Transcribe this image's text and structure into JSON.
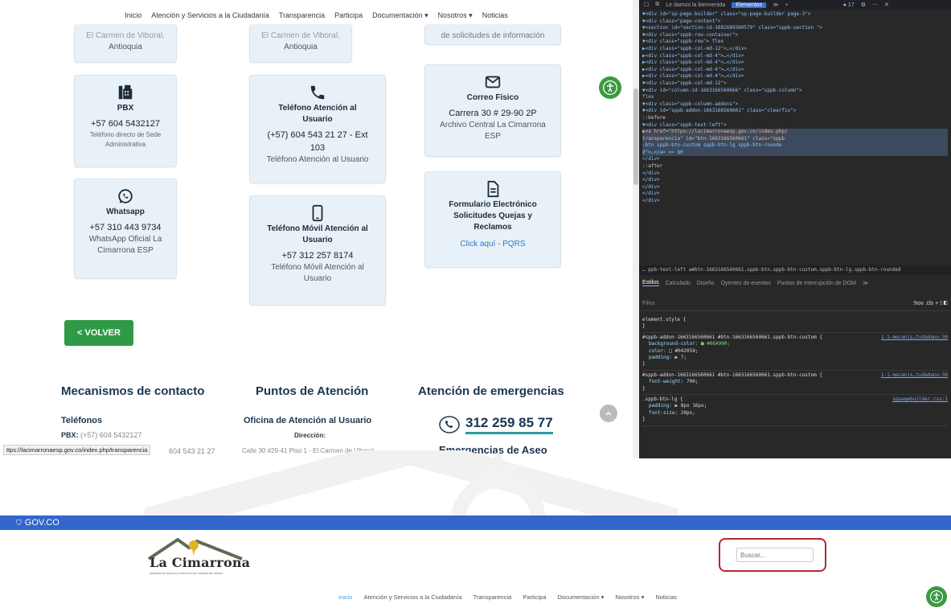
{
  "top_nav": {
    "items": [
      "Inicio",
      "Atención y Servicios a la Ciudadanía",
      "Transparencia",
      "Participa",
      "Documentación ▾",
      "Nosotros ▾",
      "Noticias"
    ]
  },
  "cards_top_partial": {
    "c1_line1": "El Carmen de Viboral,",
    "c1_line2": "Antioquia",
    "c2_line1": "El Carmen de Viboral,",
    "c2_line2": "Antioquia",
    "c3_line1": "de solicitudes de información"
  },
  "card_pbx": {
    "title": "PBX",
    "number": "+57 604 5432127",
    "desc_line1": "Teléfono directo de Sede",
    "desc_line2": "Administrativa",
    "icon": "fax-icon"
  },
  "card_tel": {
    "title_line1": "Teléfono Atención al",
    "title_line2": "Usuario",
    "number_line1": "(+57) 604 543 21 27 - Ext",
    "number_line2": "103",
    "desc": "Teléfono Atención al Usuario",
    "icon": "phone-icon"
  },
  "card_correo": {
    "title": "Correo Físico",
    "address": "Carrera 30 # 29-90 2P",
    "desc_line1": "Archivo Central La Cimarrona",
    "desc_line2": "ESP",
    "icon": "envelope-icon"
  },
  "card_whatsapp": {
    "title": "Whatsapp",
    "number": "+57 310 443 9734",
    "desc_line1": "WhatsApp Oficial La",
    "desc_line2": "Cimarrona ESP",
    "icon": "whatsapp-icon"
  },
  "card_movil": {
    "title_line1": "Teléfono Móvil Atención al",
    "title_line2": "Usuario",
    "number": "+57 312 257 8174",
    "desc_line1": "Teléfono Móvil Atención al",
    "desc_line2": "Usuario",
    "icon": "mobile-icon"
  },
  "card_form": {
    "title_line1": "Formulario Electrónico",
    "title_line2": "Solicitudes Quejas y",
    "title_line3": "Reclamos",
    "link": "Click aquí - PQRS",
    "icon": "document-icon"
  },
  "volver_label": "< VOLVER",
  "footer": {
    "mecanismos": "Mecanismos de contacto",
    "puntos": "Puntos de Atención",
    "emergencias": "Atención de emergencias",
    "telefonos": "Teléfonos",
    "pbx_label": "PBX:",
    "pbx_value": " (+57) 604 5432127",
    "partial_phone": "604 543 21 27",
    "oficina": "Oficina de Atención al Usuario",
    "direccion": "Dirección:",
    "address": "Calle 30 #29-41 Piso 1 - El Carmen de Viboral,",
    "em_phone": "312 259 85 77",
    "em_sub": "Emergencias de Aseo"
  },
  "status_url": "ttps://lacimarronaesp.gov.co/index.php/transparencia",
  "devtools": {
    "tabs": [
      "☐",
      "⧉",
      "Le damos la bienvenida",
      "Elementos",
      "≫",
      "+"
    ],
    "active_tab": "Elementos",
    "issues_count": "● 17",
    "tree": [
      "▼<div id=\"sp-page-builder\" class=\"sp-page-builder  page-3\">",
      "  ▼<div class=\"page-content\">",
      "    ▼<section id=\"section-id-1682689360579\" class=\"sppb-section \">",
      "      ▼<div class=\"sppb-row-container\">",
      "        ▼<div class=\"sppb-row\"> flex",
      "          ▶<div class=\"sppb-col-md-12\">…</div>",
      "          ▶<div class=\"sppb-col-md-4\">…</div>",
      "          ▶<div class=\"sppb-col-md-4\">…</div>",
      "          ▶<div class=\"sppb-col-md-4\">…</div>",
      "          ▶<div class=\"sppb-col-md-4\">…</div>",
      "          ▼<div class=\"sppb-col-md-12\">",
      "            ▼<div id=\"column-id-1663166560666\" class=\"sppb-column\">",
      "              flex",
      "              ▼<div class=\"sppb-column-addons\">",
      "                ▼<div id=\"sppb-addon-1663166560661\" class=\"clearfix\">",
      "                  ::before",
      "                  ▼<div class=\"sppb-text-left\">",
      "                    ▶<a href=\"https://lacimarronaesp.gov.co/index.php/",
      "                    transparencia\" id=\"btn-1663166560661\" class=\"sppb",
      "                    -btn  sppb-btn-custom sppb-btn-lg sppb-btn-rounde",
      "                    d\">…</a> == $0",
      "                  </div>",
      "                  ::after",
      "                </div>",
      "              </div>",
      "            </div>",
      "          </div>",
      "        </div>"
    ],
    "crumb": "… ppb-text-left   a#btn-1663166560661.sppb-btn.sppb-btn-custom.sppb-btn-lg.sppb-btn-rounded",
    "subtabs": [
      "Estilos",
      "Calculado",
      "Diseño",
      "Oyentes de eventos",
      "Puntos de interrupción de DOM",
      "≫"
    ],
    "filter_placeholder": "Filtro",
    "filter_tools": ":hov  .cls  +  ⟟  ◧",
    "styles": [
      {
        "selector": "element.style {",
        "props": [],
        "src": ""
      },
      {
        "selector": "#sppb-addon-1663166560661 #btn-1663166560661.sppb-btn-custom {",
        "props": [
          [
            "background-color",
            "■ #06A900;"
          ],
          [
            "color",
            "□ #042059;"
          ],
          [
            "padding",
            "▶ 7;"
          ]
        ],
        "src": "1-1-mecanis…tudadano:30"
      },
      {
        "selector": "#sppb-addon-1663166560661 #btn-1663166560661.sppb-btn-custom {",
        "props": [
          [
            "font-weight",
            "700;"
          ]
        ],
        "src": "1-1-mecanis…tudadano:30"
      },
      {
        "selector": ".sppb-btn-lg {",
        "props": [
          [
            "padding",
            "▶ 8px 16px;"
          ],
          [
            "font-size",
            "20px;"
          ]
        ],
        "src": "sppagebuilder.css:1"
      }
    ]
  },
  "bottom": {
    "gov_label": "GOV.CO",
    "logo_text": "La Cimarrona",
    "logo_tagline": "EMPRESA DE SERVICIOS PÚBLICOS DEL CARMEN DE VIBORAL",
    "search_placeholder": "Buscar...",
    "nav": [
      "Inicio",
      "Atención y Servicios a la Ciudadanía",
      "Transparencia",
      "Participa",
      "Documentación ▾",
      "Nosotros ▾",
      "Noticias"
    ],
    "active_nav": "Inicio"
  },
  "colors": {
    "card_bg": "#e9f1f8",
    "volver_green": "#2f9a46",
    "heading_navy": "#1a3550",
    "gov_blue": "#3366cc",
    "search_outline": "#b5282e",
    "accessibility_green": "#3a9a3f"
  }
}
